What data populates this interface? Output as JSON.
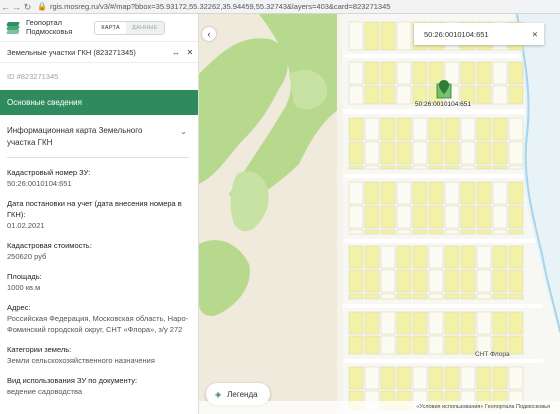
{
  "browser": {
    "url": "rgis.mosreg.ru/v3/#/map?bbox=35.93172,55.32262,35.94459,55.32743&layers=403&card=823271345"
  },
  "sidebar": {
    "logo_line1": "Геопортал",
    "logo_line2": "Подмосковья",
    "mode_map": "КАРТА",
    "mode_data": "ДАННЫЕ",
    "card_title": "Земельные участки ГКН (823271345)",
    "card_id": "ID #823271345",
    "section_title": "Основные сведения",
    "info_card_title": "Информационная карта Земельного участка ГКН",
    "fields": [
      {
        "label": "Кадастровый номер ЗУ:",
        "value": "50:26:0010104:651"
      },
      {
        "label": "Дата постановки на учет (дата внесения номера в ГКН):",
        "value": "01.02.2021"
      },
      {
        "label": "Кадастровая стоимость:",
        "value": "250620 руб"
      },
      {
        "label": "Площадь:",
        "value": "1000 кв.м"
      },
      {
        "label": "Адрес:",
        "value": "Российская Федерация, Московская область, Наро-Фоминский городской округ, СНТ «Флора», з/у 272"
      },
      {
        "label": "Категории земель:",
        "value": "Земли сельскохозяйственного назначения"
      },
      {
        "label": "Вид использования ЗУ по документу:",
        "value": "ведение садоводства"
      }
    ]
  },
  "map": {
    "search_value": "50:26:0010104:651",
    "parcel_label": "50:26:0010104:651",
    "snt_label": "СНТ Флора",
    "legend_label": "Легенда",
    "copyright": "«Условия использования» Геопортала Подмосковья"
  },
  "colors": {
    "accent": "#2f8a5e",
    "map_background": "#efeadc",
    "forest": "#b7d98e",
    "parcel_fill": "#f3f1a6",
    "selected_parcel": "#4caf50",
    "road": "#ffffff",
    "water": "#a9d3ea"
  }
}
